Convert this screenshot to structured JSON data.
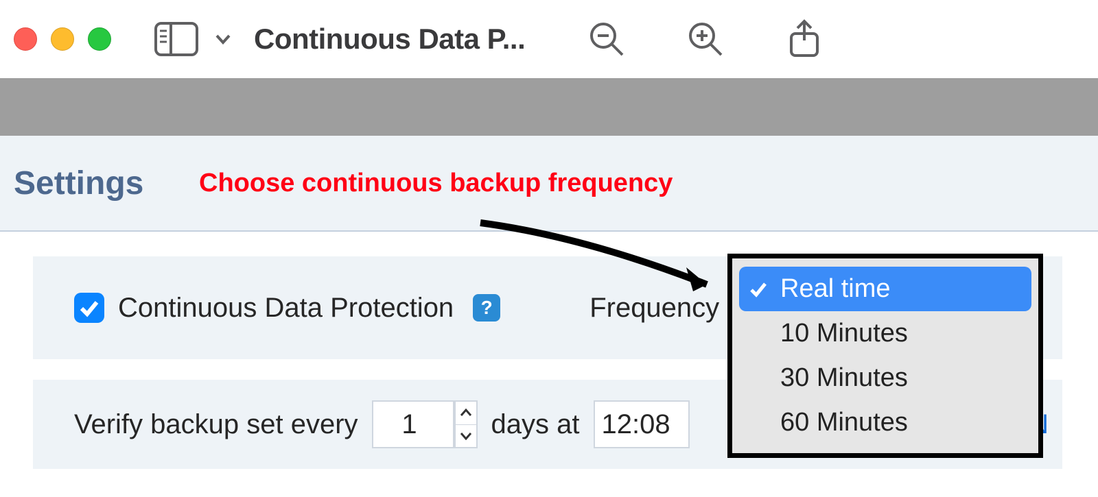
{
  "titlebar": {
    "title": "Continuous Data P..."
  },
  "settings": {
    "heading": "Settings",
    "annotation": "Choose continuous backup frequency"
  },
  "cdp": {
    "checkbox_checked": true,
    "label": "Continuous Data Protection",
    "help_symbol": "?",
    "frequency_label": "Frequency"
  },
  "frequency_dropdown": {
    "selected": "Real time",
    "options": [
      "Real time",
      "10 Minutes",
      "30 Minutes",
      "60 Minutes"
    ]
  },
  "verify": {
    "prefix": "Verify backup set every",
    "days_value": "1",
    "days_suffix": "days at",
    "time_value": "12:08",
    "link_fragment": "y N"
  }
}
